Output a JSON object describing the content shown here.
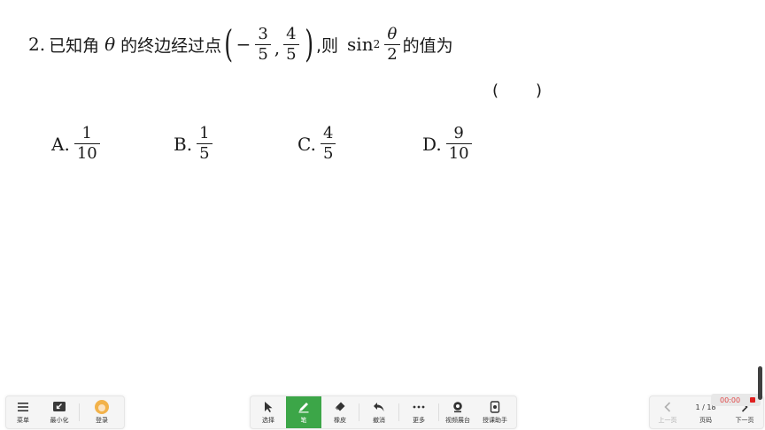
{
  "question": {
    "number": "2.",
    "text_before": "已知角",
    "theta": "θ",
    "text_mid": "的终边经过点",
    "point_x_sign": "−",
    "point_x_num": "3",
    "point_x_den": "5",
    "point_y_num": "4",
    "point_y_den": "5",
    "text_then": ",则",
    "sin": "sin",
    "sin_power": "2",
    "half_num": "θ",
    "half_den": "2",
    "text_end": "的值为",
    "answer_left": "(",
    "answer_right": ")"
  },
  "options": [
    {
      "label": "A.",
      "num": "1",
      "den": "10"
    },
    {
      "label": "B.",
      "num": "1",
      "den": "5"
    },
    {
      "label": "C.",
      "num": "4",
      "den": "5"
    },
    {
      "label": "D.",
      "num": "9",
      "den": "10"
    }
  ],
  "toolbar_left": {
    "menu": "菜单",
    "minimize": "最小化",
    "login": "登录"
  },
  "toolbar_center": {
    "select": "选择",
    "pen": "笔",
    "eraser": "橡皮",
    "undo": "撤消",
    "more": "更多",
    "video_booth": "视频展台",
    "teaching_assistant": "授课助手"
  },
  "toolbar_right": {
    "prev": "上一页",
    "page_indicator": "1 / 18",
    "page_label": "页码",
    "next": "下一页"
  },
  "timer": "00:00",
  "colors": {
    "active_tool": "#3ca648",
    "record": "#e02020"
  }
}
